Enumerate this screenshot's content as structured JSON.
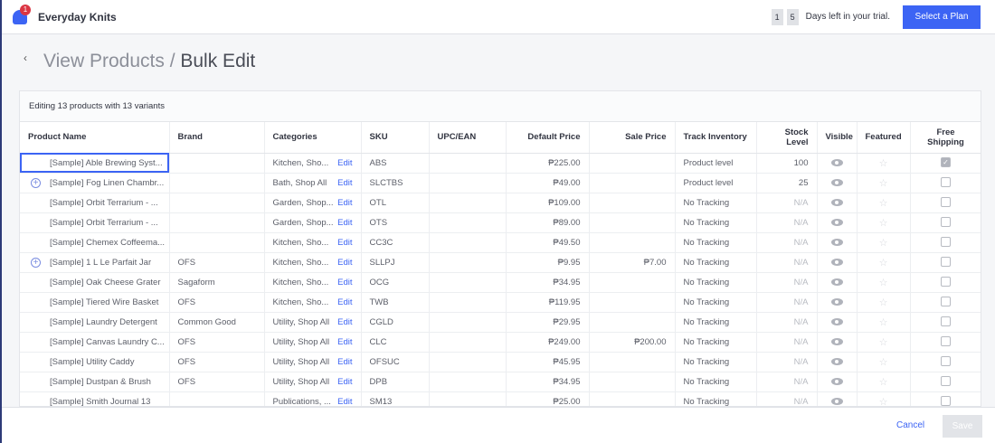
{
  "header": {
    "store_name": "Everyday Knits",
    "notification_count": "1",
    "trial_digits": [
      "1",
      "5"
    ],
    "trial_text": "Days left in your trial.",
    "plan_button": "Select a Plan",
    "accent": "#3c64f4"
  },
  "page": {
    "back_icon": "chevron-left-icon",
    "breadcrumb_parent": "View Products",
    "separator": " / ",
    "title": "Bulk Edit"
  },
  "table": {
    "info": "Editing 13 products with 13 variants",
    "columns": [
      "Product Name",
      "Brand",
      "Categories",
      "SKU",
      "UPC/EAN",
      "Default Price",
      "Sale Price",
      "Track Inventory",
      "Stock Level",
      "Visible",
      "Featured",
      "Free Shipping"
    ],
    "edit_label": "Edit",
    "rows": [
      {
        "name": "[Sample] Able Brewing Syst...",
        "brand": "",
        "categories": "Kitchen, Sho...",
        "sku": "ABS",
        "upc": "",
        "price": "₱225.00",
        "sale": "",
        "track": "Product level",
        "stock": "100",
        "expand": false,
        "free_shipping": true,
        "selected": true
      },
      {
        "name": "[Sample] Fog Linen Chambr...",
        "brand": "",
        "categories": "Bath, Shop All",
        "sku": "SLCTBS",
        "upc": "",
        "price": "₱49.00",
        "sale": "",
        "track": "Product level",
        "stock": "25",
        "expand": true,
        "free_shipping": false
      },
      {
        "name": "[Sample] Orbit Terrarium - ...",
        "brand": "",
        "categories": "Garden, Shop...",
        "sku": "OTL",
        "upc": "",
        "price": "₱109.00",
        "sale": "",
        "track": "No Tracking",
        "stock": "N/A",
        "expand": false,
        "free_shipping": false
      },
      {
        "name": "[Sample] Orbit Terrarium - ...",
        "brand": "",
        "categories": "Garden, Shop...",
        "sku": "OTS",
        "upc": "",
        "price": "₱89.00",
        "sale": "",
        "track": "No Tracking",
        "stock": "N/A",
        "expand": false,
        "free_shipping": false
      },
      {
        "name": "[Sample] Chemex Coffeema...",
        "brand": "",
        "categories": "Kitchen, Sho...",
        "sku": "CC3C",
        "upc": "",
        "price": "₱49.50",
        "sale": "",
        "track": "No Tracking",
        "stock": "N/A",
        "expand": false,
        "free_shipping": false
      },
      {
        "name": "[Sample] 1 L Le Parfait Jar",
        "brand": "OFS",
        "categories": "Kitchen, Sho...",
        "sku": "SLLPJ",
        "upc": "",
        "price": "₱9.95",
        "sale": "₱7.00",
        "track": "No Tracking",
        "stock": "N/A",
        "expand": true,
        "free_shipping": false
      },
      {
        "name": "[Sample] Oak Cheese Grater",
        "brand": "Sagaform",
        "categories": "Kitchen, Sho...",
        "sku": "OCG",
        "upc": "",
        "price": "₱34.95",
        "sale": "",
        "track": "No Tracking",
        "stock": "N/A",
        "expand": false,
        "free_shipping": false
      },
      {
        "name": "[Sample] Tiered Wire Basket",
        "brand": "OFS",
        "categories": "Kitchen, Sho...",
        "sku": "TWB",
        "upc": "",
        "price": "₱119.95",
        "sale": "",
        "track": "No Tracking",
        "stock": "N/A",
        "expand": false,
        "free_shipping": false
      },
      {
        "name": "[Sample] Laundry Detergent",
        "brand": "Common Good",
        "categories": "Utility, Shop All",
        "sku": "CGLD",
        "upc": "",
        "price": "₱29.95",
        "sale": "",
        "track": "No Tracking",
        "stock": "N/A",
        "expand": false,
        "free_shipping": false
      },
      {
        "name": "[Sample] Canvas Laundry C...",
        "brand": "OFS",
        "categories": "Utility, Shop All",
        "sku": "CLC",
        "upc": "",
        "price": "₱249.00",
        "sale": "₱200.00",
        "track": "No Tracking",
        "stock": "N/A",
        "expand": false,
        "free_shipping": false
      },
      {
        "name": "[Sample] Utility Caddy",
        "brand": "OFS",
        "categories": "Utility, Shop All",
        "sku": "OFSUC",
        "upc": "",
        "price": "₱45.95",
        "sale": "",
        "track": "No Tracking",
        "stock": "N/A",
        "expand": false,
        "free_shipping": false
      },
      {
        "name": "[Sample] Dustpan & Brush",
        "brand": "OFS",
        "categories": "Utility, Shop All",
        "sku": "DPB",
        "upc": "",
        "price": "₱34.95",
        "sale": "",
        "track": "No Tracking",
        "stock": "N/A",
        "expand": false,
        "free_shipping": false
      },
      {
        "name": "[Sample] Smith Journal 13",
        "brand": "",
        "categories": "Publications, ...",
        "sku": "SM13",
        "upc": "",
        "price": "₱25.00",
        "sale": "",
        "track": "No Tracking",
        "stock": "N/A",
        "expand": false,
        "free_shipping": false
      }
    ]
  },
  "footer": {
    "cancel": "Cancel",
    "save": "Save"
  }
}
